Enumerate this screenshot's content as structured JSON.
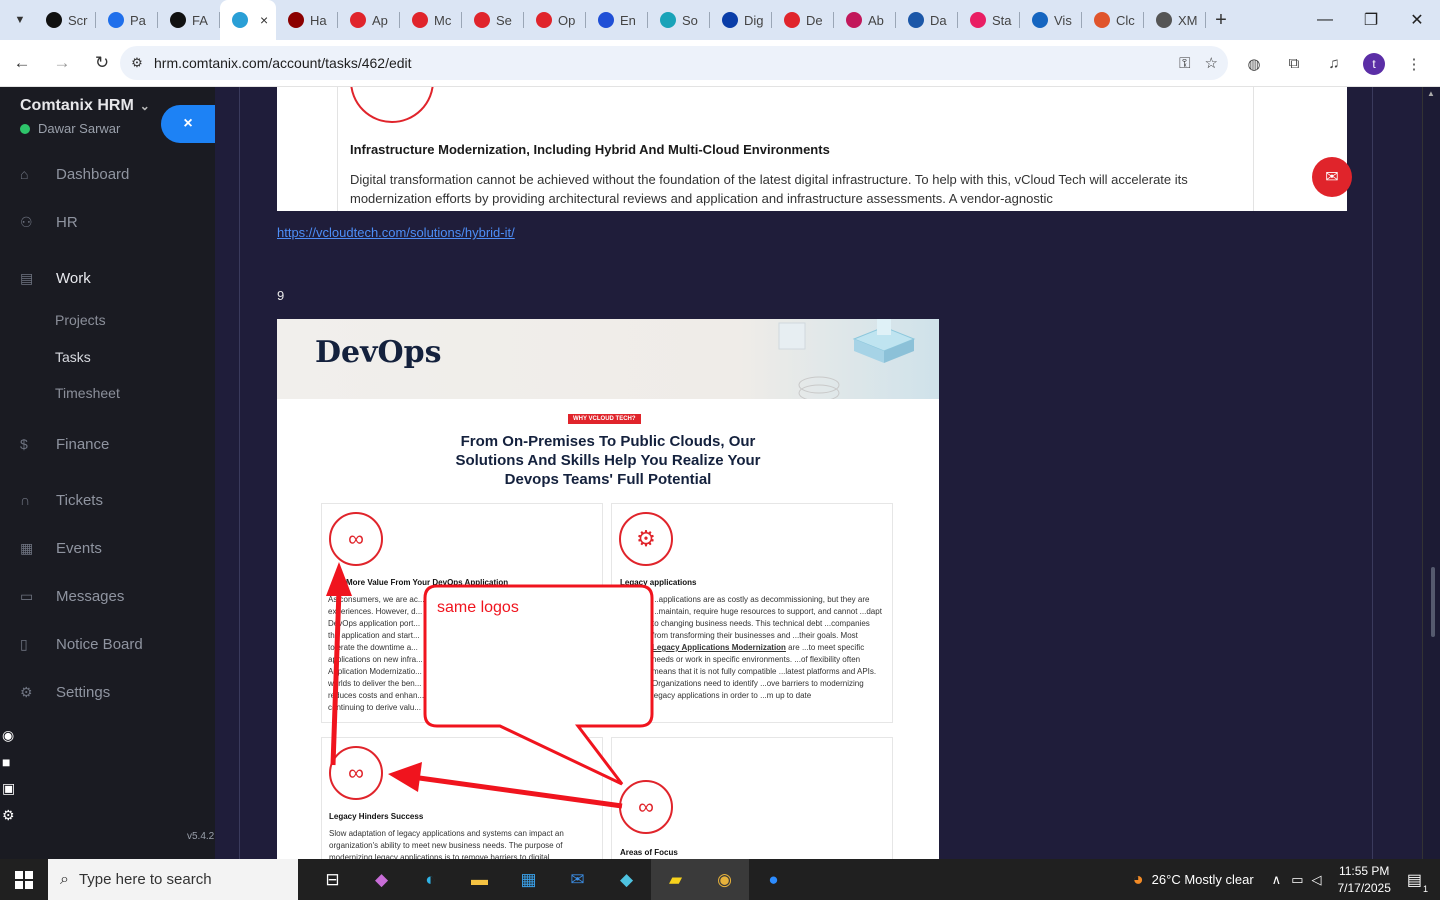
{
  "browser": {
    "tabs": [
      {
        "label": "Scr",
        "icon": "github-icon",
        "color": "#111111"
      },
      {
        "label": "Pa",
        "icon": "gauge-icon",
        "color": "#1f6feb"
      },
      {
        "label": "FA",
        "icon": "openai-icon",
        "color": "#111111"
      },
      {
        "label": "",
        "icon": "comtanix-icon",
        "color": "#2a9fd6",
        "active": true
      },
      {
        "label": "Ha",
        "icon": "v-logo-icon",
        "color": "#8b0000"
      },
      {
        "label": "Ap",
        "icon": "diamond-icon",
        "color": "#e0242b"
      },
      {
        "label": "Mc",
        "icon": "diamond-icon",
        "color": "#e0242b"
      },
      {
        "label": "Se",
        "icon": "diamond-icon",
        "color": "#e0242b"
      },
      {
        "label": "Op",
        "icon": "diamond-icon",
        "color": "#e0242b"
      },
      {
        "label": "En",
        "icon": "check-icon",
        "color": "#1f4fd6"
      },
      {
        "label": "So",
        "icon": "circle-icon",
        "color": "#1aa3b8"
      },
      {
        "label": "Dig",
        "icon": "x-icon",
        "color": "#0a3da8"
      },
      {
        "label": "De",
        "icon": "diamond-icon",
        "color": "#e0242b"
      },
      {
        "label": "Ab",
        "icon": "ball-icon",
        "color": "#c2185b"
      },
      {
        "label": "Da",
        "icon": "scale-icon",
        "color": "#1b57a8"
      },
      {
        "label": "Sta",
        "icon": "bolt-icon",
        "color": "#e91e63"
      },
      {
        "label": "Vis",
        "icon": "wave-icon",
        "color": "#1565c0"
      },
      {
        "label": "Clc",
        "icon": "slash-icon",
        "color": "#e0542b"
      },
      {
        "label": "XM",
        "icon": "globe-icon",
        "color": "#555555"
      }
    ],
    "url": "hrm.comtanix.com/account/tasks/462/edit",
    "avatar_letter": "t"
  },
  "sidebar": {
    "company": "Comtanix HRM",
    "user": "Dawar Sarwar",
    "close_icon": "×",
    "version": "v5.4.2",
    "items": [
      {
        "label": "Dashboard",
        "icon": "home-icon"
      },
      {
        "label": "HR",
        "icon": "users-icon"
      },
      {
        "label": "Work",
        "icon": "briefcase-icon",
        "active": true
      },
      {
        "label": "Finance",
        "icon": "dollar-icon"
      },
      {
        "label": "Tickets",
        "icon": "headset-icon"
      },
      {
        "label": "Events",
        "icon": "calendar-icon"
      },
      {
        "label": "Messages",
        "icon": "message-icon"
      },
      {
        "label": "Notice Board",
        "icon": "clipboard-icon"
      },
      {
        "label": "Settings",
        "icon": "gear-icon"
      }
    ],
    "work_sub": [
      "Projects",
      "Tasks",
      "Timesheet"
    ]
  },
  "editor": {
    "img1_heading": "Infrastructure Modernization, Including Hybrid And Multi-Cloud Environments",
    "img1_text": "Digital transformation cannot be achieved without the foundation of the latest digital infrastructure. To help with this, vCloud Tech will accelerate its modernization efforts by providing architectural reviews and application and infrastructure assessments. A vendor-agnostic",
    "link": "https://vcloudtech.com/solutions/hybrid-it/",
    "number_line": "9",
    "devops": {
      "title": "DevOps",
      "badge": "WHY VCLOUD TECH?",
      "heading": "From On-Premises To Public Clouds, Our Solutions And Skills Help You Realize Your Devops Teams' Full Potential",
      "card1_title": "More Value From Your DevOps Application",
      "card1_text": "As consumers, we are ac... experiences. However, d... DevOps application port... the application and start... tolerate the downtime a... applications on new infra... Application Modernizatio... worlds to deliver the ben... reduces costs and enhan... continuing to derive valu...",
      "card2_title": "Legacy applications",
      "card2_text_a": "...applications are as costly as decommissioning, but they are ...maintain, require huge resources to support, and cannot ...dapt to changing business needs. This technical debt ...companies from transforming their businesses and ...their goals. Most ",
      "card2_link": "Legacy Applications Modernization",
      "card2_text_b": " are ...to meet specific needs or work in specific environments. ...of flexibility often means that it is not fully compatible ...latest platforms and APIs. Organizations need to identify ...ove barriers to modernizing legacy applications in order to ...m up to date",
      "card3_title": "Legacy Hinders Success",
      "card3_text": "Slow adaptation of legacy applications and systems can impact an organization's ability to meet new business needs. The purpose of modernizing legacy applications is to remove barriers to digital",
      "card4_title": "Areas of Focus"
    },
    "callout_text": "same logos"
  },
  "taskbar": {
    "search_placeholder": "Type here to search",
    "weather": "26°C  Mostly clear",
    "time": "11:55 PM",
    "date": "7/17/2025",
    "notification_count": "1"
  }
}
